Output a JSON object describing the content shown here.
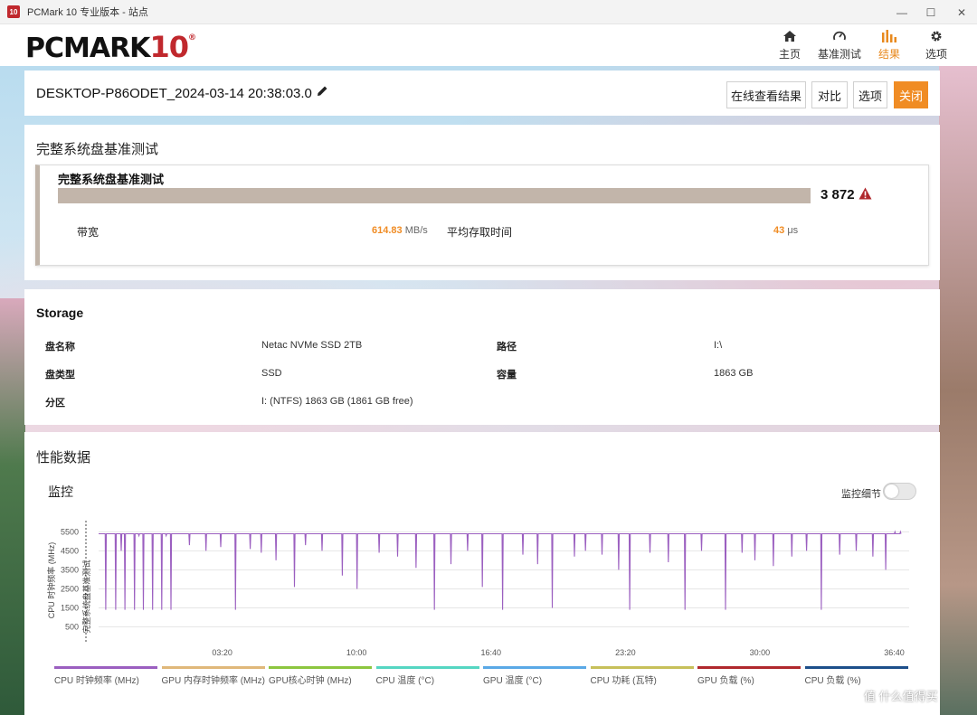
{
  "window": {
    "badge": "10",
    "title": "PCMark 10 专业版本 - 站点",
    "controls": {
      "minimize": "—",
      "maximize": "☐",
      "close": "✕"
    }
  },
  "header": {
    "logo_text": "PCMARK",
    "logo_num": "10",
    "logo_reg": "®",
    "nav": [
      {
        "label": "主页",
        "icon": "home-icon",
        "active": false
      },
      {
        "label": "基准测试",
        "icon": "gauge-icon",
        "active": false
      },
      {
        "label": "结果",
        "icon": "bar-chart-icon",
        "active": true
      },
      {
        "label": "选项",
        "icon": "gear-icon",
        "active": false
      }
    ]
  },
  "result_header": {
    "name": "DESKTOP-P86ODET_2024-03-14 20:38:03.0",
    "buttons": {
      "online": "在线查看结果",
      "compare": "对比",
      "options": "选项",
      "close": "关闭"
    }
  },
  "disk_test": {
    "section_title": "完整系统盘基准测试",
    "card_title": "完整系统盘基准测试",
    "score": "3 872",
    "bandwidth_label": "带宽",
    "bandwidth_value": "614.83",
    "bandwidth_unit": "MB/s",
    "latency_label": "平均存取时间",
    "latency_value": "43",
    "latency_unit": "μs",
    "accent": "#f08c24"
  },
  "storage": {
    "title": "Storage",
    "rows": [
      {
        "k1": "盘名称",
        "v1": "Netac NVMe SSD 2TB",
        "k2": "路径",
        "v2": "I:\\"
      },
      {
        "k1": "盘类型",
        "v1": "SSD",
        "k2": "容量",
        "v2": "1863 GB"
      },
      {
        "k1": "分区",
        "v1": "I: (NTFS) 1863 GB (1861 GB free)",
        "k2": "",
        "v2": ""
      }
    ]
  },
  "performance": {
    "title": "性能数据",
    "monitor_title": "监控",
    "toggle_label": "监控细节",
    "legend": [
      {
        "label": "CPU 时钟频率 (MHz)",
        "color": "#9b5fc0"
      },
      {
        "label": "GPU 内存时钟频率 (MHz)",
        "color": "#e0b87a"
      },
      {
        "label": "GPU核心时钟 (MHz)",
        "color": "#8cc63f"
      },
      {
        "label": "CPU 温度 (°C)",
        "color": "#55d6c2"
      },
      {
        "label": "GPU 温度 (°C)",
        "color": "#5aa9e6"
      },
      {
        "label": "CPU 功耗 (瓦特)",
        "color": "#c7c05a"
      },
      {
        "label": "GPU 负载 (%)",
        "color": "#b0282d"
      },
      {
        "label": "CPU 负载 (%)",
        "color": "#1d4f8a"
      }
    ]
  },
  "chart_data": {
    "type": "line",
    "ylabel": "CPU 时钟频率 (MHz)",
    "overlay_label": "完整系统盘基准测试",
    "yticks": [
      500,
      1500,
      2500,
      3500,
      4500,
      5500
    ],
    "ylim": [
      0,
      5900
    ],
    "xticks": [
      "03:20",
      "10:00",
      "16:40",
      "23:20",
      "30:00",
      "36:40"
    ],
    "xlim_seconds": [
      0,
      2200
    ],
    "series": [
      {
        "name": "CPU 时钟频率 (MHz)",
        "color": "#9b5fc0",
        "baseline": 5400,
        "points_seconds": [
          [
            0,
            5400
          ],
          [
            18,
            1400
          ],
          [
            30,
            5400
          ],
          [
            45,
            1400
          ],
          [
            60,
            4500
          ],
          [
            70,
            1400
          ],
          [
            82,
            5400
          ],
          [
            96,
            1400
          ],
          [
            108,
            5300
          ],
          [
            120,
            1400
          ],
          [
            130,
            5400
          ],
          [
            145,
            1400
          ],
          [
            158,
            5400
          ],
          [
            170,
            1400
          ],
          [
            182,
            5300
          ],
          [
            195,
            1400
          ],
          [
            205,
            5400
          ],
          [
            245,
            4800
          ],
          [
            290,
            4500
          ],
          [
            330,
            4700
          ],
          [
            370,
            1400
          ],
          [
            410,
            4600
          ],
          [
            440,
            4400
          ],
          [
            480,
            4000
          ],
          [
            530,
            2600
          ],
          [
            560,
            4800
          ],
          [
            605,
            4500
          ],
          [
            660,
            3200
          ],
          [
            700,
            2500
          ],
          [
            760,
            4400
          ],
          [
            810,
            4200
          ],
          [
            860,
            3600
          ],
          [
            910,
            1400
          ],
          [
            955,
            3800
          ],
          [
            1000,
            4500
          ],
          [
            1040,
            2600
          ],
          [
            1095,
            1400
          ],
          [
            1150,
            4300
          ],
          [
            1190,
            3800
          ],
          [
            1230,
            1500
          ],
          [
            1290,
            4200
          ],
          [
            1320,
            4500
          ],
          [
            1365,
            4300
          ],
          [
            1410,
            3500
          ],
          [
            1440,
            1400
          ],
          [
            1495,
            4400
          ],
          [
            1545,
            3900
          ],
          [
            1590,
            1400
          ],
          [
            1635,
            4500
          ],
          [
            1700,
            1400
          ],
          [
            1745,
            4400
          ],
          [
            1780,
            4000
          ],
          [
            1830,
            3700
          ],
          [
            1880,
            4200
          ],
          [
            1920,
            4500
          ],
          [
            1960,
            1400
          ],
          [
            2010,
            4300
          ],
          [
            2055,
            4500
          ],
          [
            2100,
            4200
          ],
          [
            2135,
            3500
          ],
          [
            2160,
            5500
          ],
          [
            2175,
            5500
          ]
        ]
      }
    ]
  }
}
